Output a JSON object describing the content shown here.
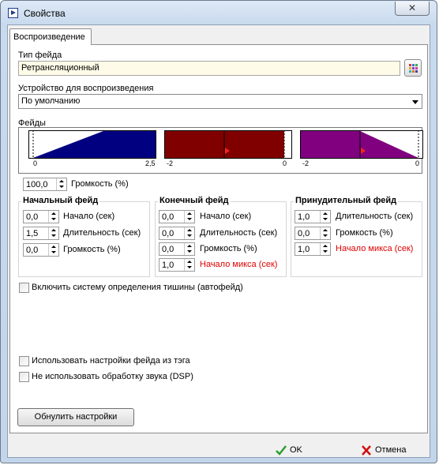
{
  "window": {
    "title": "Свойства",
    "close_glyph": "✕"
  },
  "tabs": [
    {
      "label": "Воспроизведение"
    }
  ],
  "fade_type": {
    "label": "Тип фейда",
    "value": "Ретрансляционный",
    "picker_icon": "color-grid-icon"
  },
  "device": {
    "label": "Устройство для воспроизведения",
    "value": "По умолчанию"
  },
  "fades_section": {
    "label": "Фейды",
    "graphs": [
      {
        "color": "#000080",
        "min_label": "0",
        "max_label": "2,5"
      },
      {
        "color": "#800000",
        "min_label": "-2",
        "max_label": "0"
      },
      {
        "color": "#800080",
        "min_label": "-2",
        "max_label": "0"
      }
    ]
  },
  "volume": {
    "value": "100,0",
    "label": "Громкость (%)"
  },
  "start_fade": {
    "title": "Начальный фейд",
    "rows": [
      {
        "value": "0,0",
        "label": "Начало (сек)"
      },
      {
        "value": "1,5",
        "label": "Длительность (сек)"
      },
      {
        "value": "0,0",
        "label": "Громкость (%)"
      }
    ]
  },
  "end_fade": {
    "title": "Конечный фейд",
    "rows": [
      {
        "value": "0,0",
        "label": "Начало (сек)"
      },
      {
        "value": "0,0",
        "label": "Длительность (сек)"
      },
      {
        "value": "0,0",
        "label": "Громкость (%)"
      },
      {
        "value": "1,0",
        "label": "Начало микса (сек)"
      }
    ]
  },
  "forced_fade": {
    "title": "Принудительный фейд",
    "rows": [
      {
        "value": "1,0",
        "label": "Длительность (сек)"
      },
      {
        "value": "0,0",
        "label": "Громкость (%)"
      },
      {
        "value": "1,0",
        "label": "Начало микса (сек)"
      }
    ]
  },
  "checkboxes": {
    "silence": "Включить систему определения тишины (автофейд)",
    "tag_fade": "Использовать настройки фейда из тэга",
    "no_dsp": "Не использовать обработку звука (DSP)"
  },
  "reset_button": "Обнулить настройки",
  "footer": {
    "ok": "OK",
    "cancel": "Отмена"
  },
  "colors": {
    "accent_red": "#e00000",
    "ok_green": "#2e9e2e",
    "cancel_red": "#d01010"
  }
}
